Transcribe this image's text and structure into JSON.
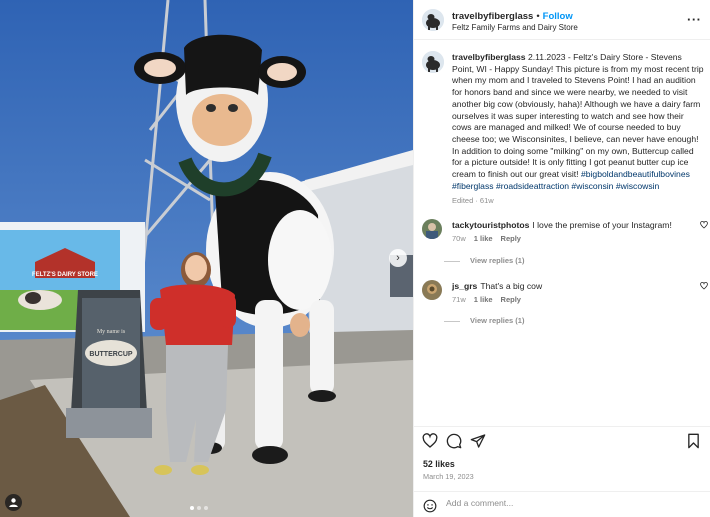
{
  "header": {
    "username": "travelbyfiberglass",
    "separator": "•",
    "follow_label": "Follow",
    "location": "Feltz Family Farms and Dairy Store",
    "more_icon": "more-horizontal-icon"
  },
  "photo": {
    "store_sign": "FELTZ'S DAIRY STORE",
    "board_text": "BUTTERCUP",
    "board_sub": "My name is",
    "next_icon": "chevron-right-icon",
    "tag_icon": "user-tag-icon"
  },
  "caption": {
    "username": "travelbyfiberglass",
    "text": " 2.11.2023 - Feltz's Dairy Store - Stevens Point, WI - Happy Sunday! This picture is from my most recent trip when my mom and I traveled to Stevens Point! I had an audition for honors band and since we were nearby, we needed to visit another big cow (obviously, haha)! Although we have a dairy farm ourselves it was super interesting to watch and see how their cows are managed and milked! We of course needed to buy cheese too; we Wisconsinites, I believe, can never have enough! In addition to doing some \"milking\" on my own, Buttercup called for a picture outside! It is only fitting I got peanut butter cup ice cream to finish out our great visit! ",
    "hashtags": "#bigboldandbeautifulbovines #fiberglass #roadsideattraction #wisconsin #wiscowsin",
    "edited": "Edited · 61w"
  },
  "comments": [
    {
      "username": "tackytouristphotos",
      "text": "I love the premise of your Instagram!",
      "age": "70w",
      "likes": "1 like",
      "reply_label": "Reply",
      "view_replies": "View replies (1)"
    },
    {
      "username": "js_grs",
      "text": "That's a big cow",
      "age": "71w",
      "likes": "1 like",
      "reply_label": "Reply",
      "view_replies": "View replies (1)"
    }
  ],
  "actions": {
    "like_icon": "heart-icon",
    "comment_icon": "comment-icon",
    "share_icon": "send-icon",
    "save_icon": "bookmark-icon",
    "likes_count": "52 likes",
    "date": "March 19, 2023"
  },
  "add_comment": {
    "placeholder": "Add a comment...",
    "emoji_icon": "smiley-icon"
  },
  "colors": {
    "follow": "#0095f6",
    "hashtag": "#00376b",
    "muted": "#8e8e8e",
    "sky": "#3b6fb8"
  }
}
